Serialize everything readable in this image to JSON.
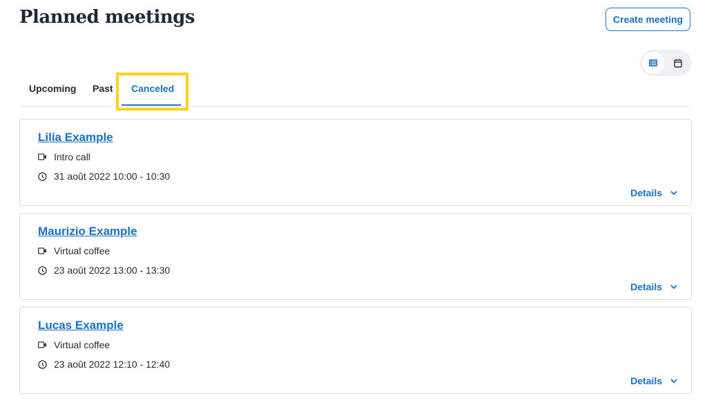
{
  "header": {
    "title": "Planned meetings",
    "create_button": "Create meeting"
  },
  "view_toggle": {
    "options": [
      {
        "icon": "list-icon",
        "selected": true
      },
      {
        "icon": "calendar-icon",
        "selected": false
      }
    ]
  },
  "tabs": [
    {
      "label": "Upcoming",
      "active": false
    },
    {
      "label": "Past",
      "active": false
    },
    {
      "label": "Canceled",
      "active": true
    }
  ],
  "meetings": [
    {
      "name": "Lilia Example",
      "type": "Intro call",
      "datetime": "31 août 2022 10:00 - 10:30",
      "details_label": "Details"
    },
    {
      "name": "Maurizio Example",
      "type": "Virtual coffee",
      "datetime": "23 août 2022 13:00 - 13:30",
      "details_label": "Details"
    },
    {
      "name": "Lucas Example",
      "type": "Virtual coffee",
      "datetime": "23 août 2022 12:10 - 12:40",
      "details_label": "Details"
    }
  ],
  "colors": {
    "accent": "#1770c4",
    "highlight": "#f7d417"
  }
}
